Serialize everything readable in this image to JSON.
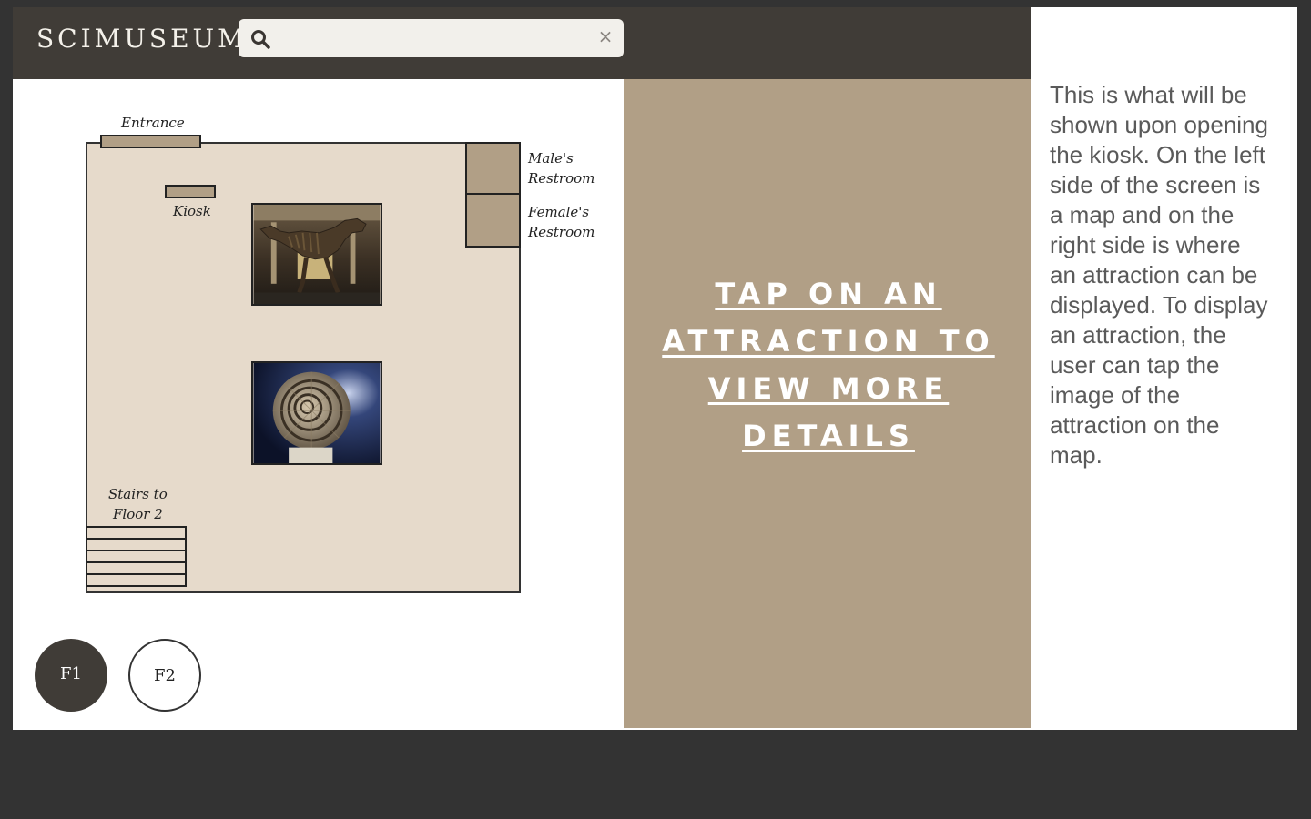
{
  "header": {
    "logo": "SCIMUSEUM",
    "search": {
      "value": "",
      "placeholder": "",
      "clear_symbol": "×"
    }
  },
  "map": {
    "labels": {
      "entrance": "Entrance",
      "kiosk": "Kiosk",
      "male_restroom_line1": "Male's",
      "male_restroom_line2": "Restroom",
      "female_restroom_line1": "Female's",
      "female_restroom_line2": "Restroom",
      "stairs_line1": "Stairs to",
      "stairs_line2": "Floor 2"
    },
    "attractions": [
      {
        "icon": "dinosaur-skeleton"
      },
      {
        "icon": "ammonite-fossil"
      }
    ],
    "floor_buttons": [
      {
        "label": "F1",
        "selected": true
      },
      {
        "label": "F2",
        "selected": false
      }
    ]
  },
  "details": {
    "cta": "TAP ON AN ATTRACTION TO VIEW MORE DETAILS"
  },
  "note": "This is what will be shown upon opening the kiosk. On the left side of the screen is a map and on the right side is where an attraction can be displayed. To display an attraction, the user can tap the image of the attraction on the map.",
  "colors": {
    "header": "#403c37",
    "tan": "#b19f86",
    "floor": "#e6dacb",
    "background": "#333333"
  }
}
